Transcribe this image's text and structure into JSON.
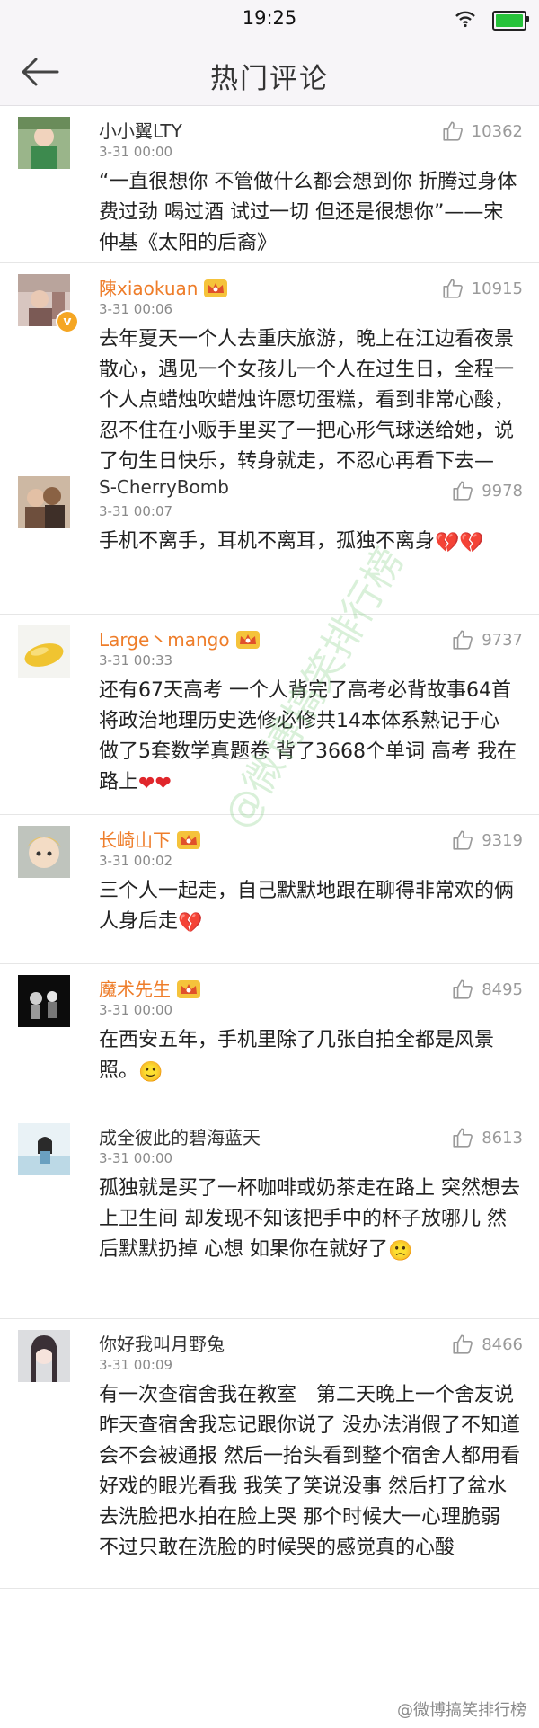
{
  "status": {
    "time": "19:25",
    "battery_level": 1.0,
    "battery_color": "#27c23a"
  },
  "header": {
    "title": "热门评论",
    "back_icon": "arrow-left-icon"
  },
  "comments": [
    {
      "name": "小小翼LTY",
      "vip": false,
      "verified": false,
      "time": "3-31 00:00",
      "likes": "10362",
      "text": "“一直很想你 不管做什么都会想到你 折腾过身体 费过劲 喝过酒 试过一切 但还是很想你”——宋仲基《太阳的后裔》",
      "emoji": ""
    },
    {
      "name": "陳xiaokuan",
      "vip": true,
      "verified": true,
      "time": "3-31 00:06",
      "likes": "10915",
      "text": "去年夏天一个人去重庆旅游，晚上在江边看夜景散心，遇见一个女孩儿一个人在过生日，全程一个人点蜡烛吹蜡烛许愿切蛋糕，看到非常心酸，忍不住在小贩手里买了一把心形气球送给她，说了句生日快乐，转身就走，不忍心再看下去—",
      "emoji": ""
    },
    {
      "name": "S-CherryBomb",
      "vip": false,
      "verified": false,
      "time": "3-31 00:07",
      "likes": "9978",
      "text": "手机不离手，耳机不离耳，孤独不离身",
      "emoji": "💔💔"
    },
    {
      "name": "Large丶mango",
      "vip": true,
      "verified": false,
      "time": "3-31 00:33",
      "likes": "9737",
      "text": "还有67天高考 一个人背完了高考必背故事64首 将政治地理历史选修必修共14本体系熟记于心 做了5套数学真题卷 背了3668个单词 高考 我在路上",
      "emoji": "❤❤"
    },
    {
      "name": "长崎山下",
      "vip": true,
      "verified": false,
      "time": "3-31 00:02",
      "likes": "9319",
      "text": "三个人一起走，自己默默地跟在聊得非常欢的俩人身后走",
      "emoji": "💔"
    },
    {
      "name": "魔术先生",
      "vip": true,
      "verified": false,
      "time": "3-31 00:00",
      "likes": "8495",
      "text": "在西安五年，手机里除了几张自拍全都是风景照。",
      "emoji": "🙂"
    },
    {
      "name": "成全彼此的碧海蓝天",
      "vip": false,
      "verified": false,
      "time": "3-31 00:00",
      "likes": "8613",
      "text": "孤独就是买了一杯咖啡或奶茶走在路上 突然想去上卫生间 却发现不知该把手中的杯子放哪儿 然后默默扔掉 心想 如果你在就好了",
      "emoji": "🙁"
    },
    {
      "name": "你好我叫月野兔",
      "vip": false,
      "verified": false,
      "time": "3-31 00:09",
      "likes": "8466",
      "text": "有一次查宿舍我在教室　第二天晚上一个舍友说昨天查宿舍我忘记跟你说了 没办法消假了不知道会不会被通报 然后一抬头看到整个宿舍人都用看好戏的眼光看我 我笑了笑说没事 然后打了盆水去洗脸把水拍在脸上哭 那个时候大一心理脆弱 不过只敢在洗脸的时候哭的感觉真的心酸",
      "emoji": ""
    }
  ],
  "watermark": "@微博搞笑排行榜",
  "credit": "@微博搞笑排行榜",
  "colors": {
    "vip_name": "#ee7d2a",
    "verified": "#f5a623"
  }
}
